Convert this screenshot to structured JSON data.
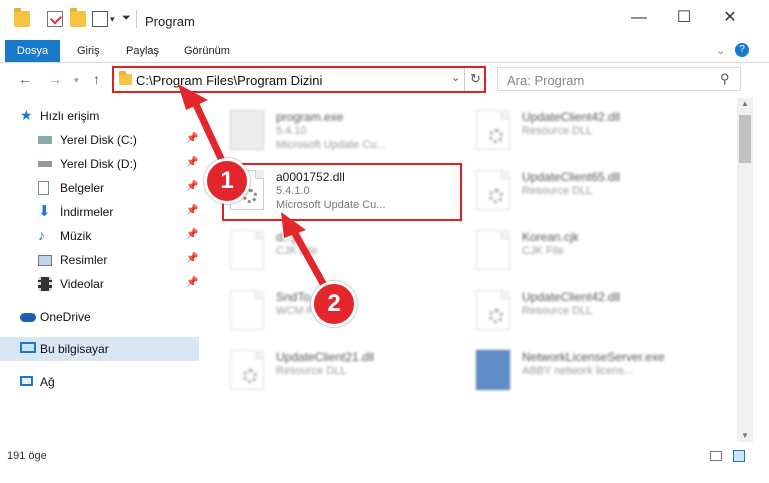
{
  "window": {
    "title": "Program",
    "minimize": "—",
    "maximize": "☐",
    "close": "✕"
  },
  "ribbon": {
    "tabs": [
      "Dosya",
      "Giriş",
      "Paylaş",
      "Görünüm"
    ],
    "help": "?"
  },
  "address": {
    "path": "C:\\Program Files\\Program Dizini"
  },
  "search": {
    "placeholder": "Ara: Program"
  },
  "sidebar": {
    "items": [
      {
        "label": "Hızlı erişim"
      },
      {
        "label": "Yerel Disk (C:)"
      },
      {
        "label": "Yerel Disk (D:)"
      },
      {
        "label": "Belgeler"
      },
      {
        "label": "İndirmeler"
      },
      {
        "label": "Müzik"
      },
      {
        "label": "Resimler"
      },
      {
        "label": "Videolar"
      },
      {
        "label": "OneDrive"
      },
      {
        "label": "Bu bilgisayar"
      },
      {
        "label": "Ağ"
      }
    ]
  },
  "files": [
    {
      "name": "program.exe",
      "version": "5.4.10",
      "desc": "Microsoft Update Cu..."
    },
    {
      "name": "a0001752.dll",
      "version": "5.4.1.0",
      "desc": "Microsoft Update Cu..."
    },
    {
      "name": "UpdateClient42.dll",
      "desc": "Resource DLL"
    },
    {
      "name": "UpdateClient65.dll",
      "desc": "Resource DLL"
    },
    {
      "name": "Korean.cjk",
      "desc": "CJK File"
    },
    {
      "name": "UpdateClient42.dll",
      "desc": "Resource DLL"
    },
    {
      "name": "UpdateClient21.dll",
      "desc": "Resource DLL"
    },
    {
      "name": "NetworkLicenseServer.exe",
      "desc": "ABBY network licens..."
    },
    {
      "name": "SndTo...wcm",
      "desc": "WCM File"
    },
    {
      "name": "d...jk",
      "desc": "CJK File"
    }
  ],
  "status": {
    "count": "191 öge"
  },
  "callouts": [
    "1",
    "2"
  ],
  "colors": {
    "accent": "#1979ca",
    "highlight": "#e32020"
  }
}
